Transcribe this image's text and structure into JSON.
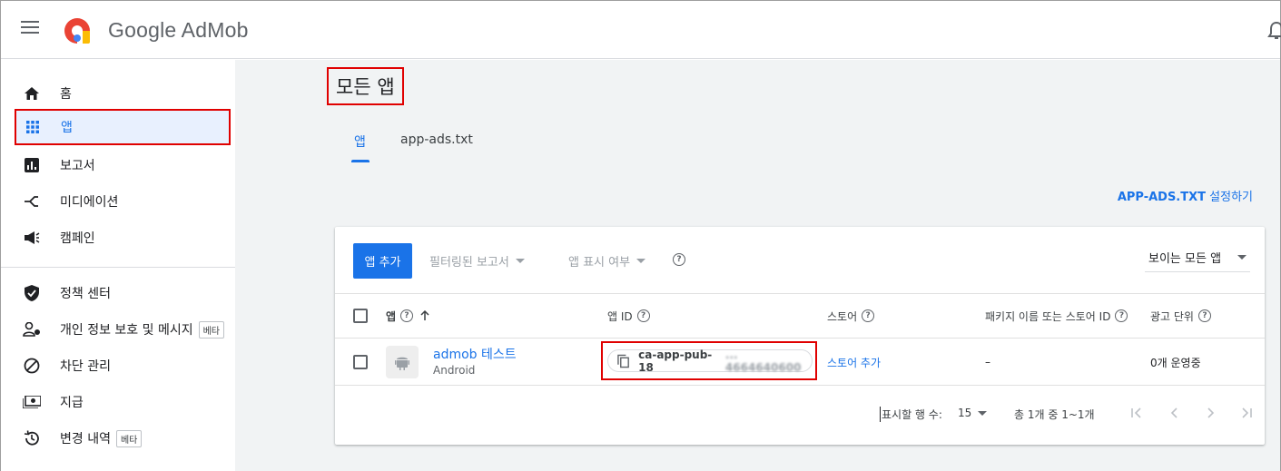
{
  "header": {
    "brand": "Google AdMob"
  },
  "sidebar": {
    "items": [
      {
        "label": "홈",
        "icon": "home-icon"
      },
      {
        "label": "앱",
        "icon": "apps-grid-icon"
      },
      {
        "label": "보고서",
        "icon": "report-icon"
      },
      {
        "label": "미디에이션",
        "icon": "mediation-icon"
      },
      {
        "label": "캠페인",
        "icon": "campaign-icon"
      },
      {
        "label": "정책 센터",
        "icon": "shield-icon"
      },
      {
        "label": "개인 정보 보호 및 메시지",
        "icon": "privacy-icon",
        "badge": "베타"
      },
      {
        "label": "차단 관리",
        "icon": "block-icon"
      },
      {
        "label": "지급",
        "icon": "payments-icon"
      },
      {
        "label": "변경 내역",
        "icon": "history-icon",
        "badge": "베타"
      }
    ]
  },
  "main": {
    "title": "모든 앱",
    "tabs": [
      {
        "label": "앱"
      },
      {
        "label": "app-ads.txt"
      }
    ],
    "link_bold": "APP-ADS.TXT",
    "link_rest": " 설정하기",
    "toolbar": {
      "add_label": "앱 추가",
      "filter_label": "필터링된 보고서",
      "visibility_label": "앱 표시 여부",
      "view_label": "보이는 모든 앱"
    },
    "table": {
      "headers": {
        "app": "앱",
        "app_id": "앱 ID",
        "store": "스토어",
        "package": "패키지 이름 또는 스토어 ID",
        "ad_units": "광고 단위"
      },
      "row": {
        "name": "admob 테스트",
        "platform": "Android",
        "app_id_visible": "ca-app-pub-18",
        "app_id_hidden": "... 4664640600",
        "store": "스토어 추가",
        "package": "–",
        "ad_units": "0개 운영중"
      }
    },
    "pager": {
      "rows_label": "표시할 행 수:",
      "rows_value": "15",
      "range": "총 1개 중 1~1개"
    }
  },
  "colors": {
    "accent": "#1a73e8",
    "highlight": "#e00000"
  }
}
